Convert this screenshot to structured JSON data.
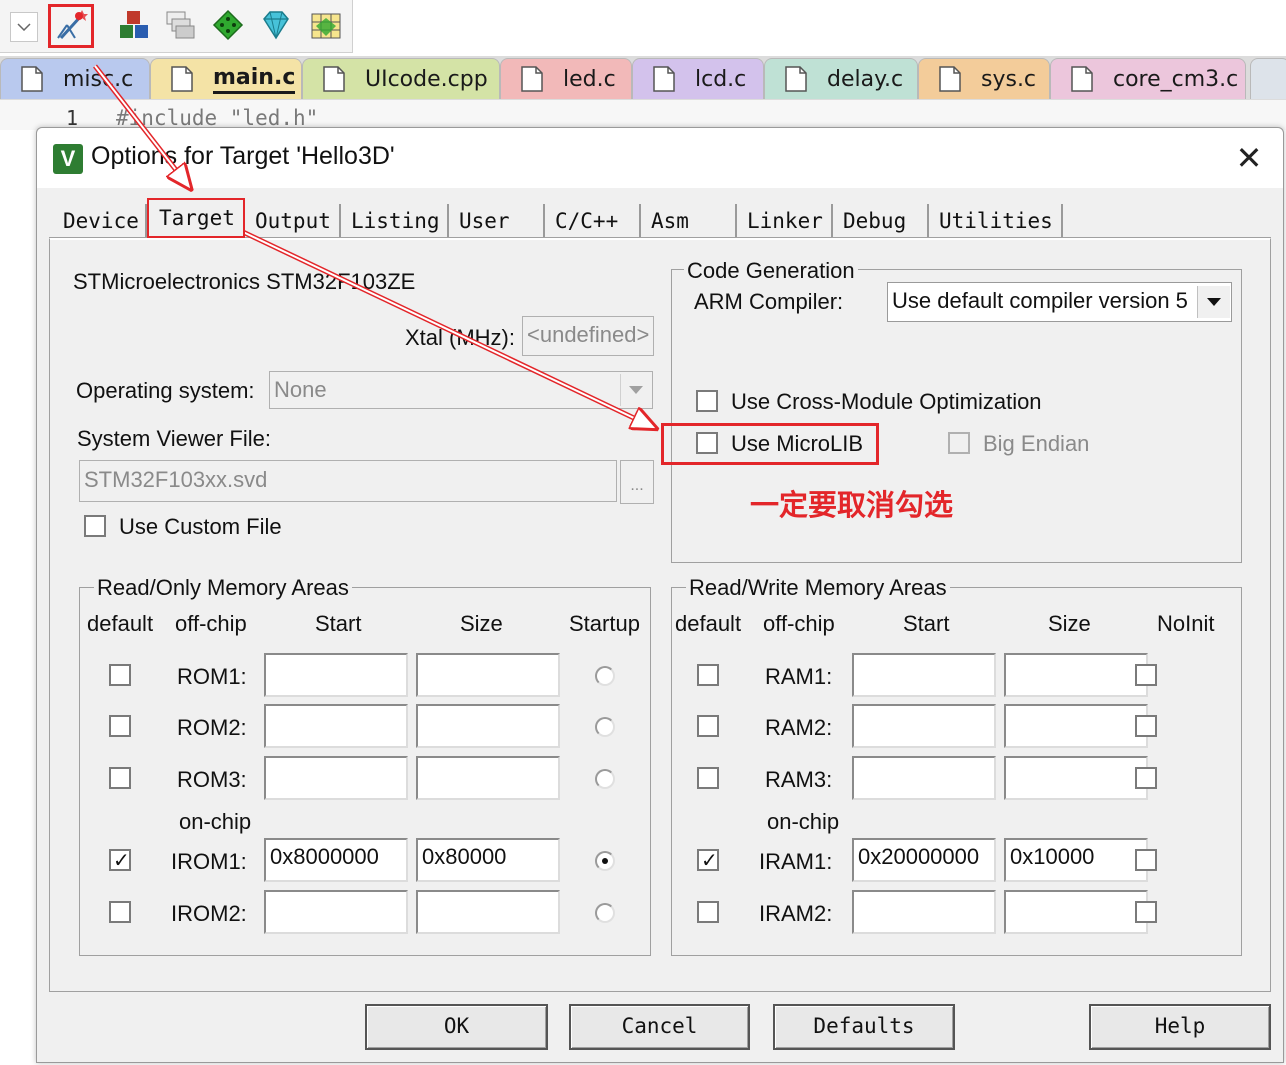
{
  "toolbar": {
    "icons": [
      "dropdown-icon",
      "magic-wand-options-icon",
      "blocks-icon",
      "windows-stack-icon",
      "green-diamond-icon",
      "gem-icon",
      "grid-gem-icon"
    ]
  },
  "editor": {
    "tabs": [
      {
        "label": "misc.c",
        "color": "#b9c9ee",
        "active": false
      },
      {
        "label": "main.c",
        "color": "#f4e3a6",
        "active": true
      },
      {
        "label": "UIcode.cpp",
        "color": "#d4e3a6",
        "active": false
      },
      {
        "label": "led.c",
        "color": "#f2b9b9",
        "active": false
      },
      {
        "label": "lcd.c",
        "color": "#d3c2ec",
        "active": false
      },
      {
        "label": "delay.c",
        "color": "#bfe1d5",
        "active": false
      },
      {
        "label": "sys.c",
        "color": "#f3cc9a",
        "active": false
      },
      {
        "label": "core_cm3.c",
        "color": "#ecc6dc",
        "active": false
      }
    ],
    "line_number": "1",
    "code_line": "#include \"led.h\""
  },
  "dialog": {
    "title": "Options for Target 'Hello3D'",
    "icon_letter": "V",
    "close_symbol": "✕",
    "tabs": [
      "Device",
      "Target",
      "Output",
      "Listing",
      "User",
      "C/C++",
      "Asm",
      "Linker",
      "Debug",
      "Utilities"
    ],
    "active_tab": "Target"
  },
  "target": {
    "device": "STMicroelectronics STM32F103ZE",
    "xtal_label": "Xtal (MHz):",
    "xtal_value": "<undefined>",
    "os_label": "Operating system:",
    "os_value": "None",
    "svd_label": "System Viewer File:",
    "svd_value": "STM32F103xx.svd",
    "browse_label": "...",
    "use_custom_file": "Use Custom File"
  },
  "code_gen": {
    "group_label": "Code Generation",
    "compiler_label": "ARM Compiler:",
    "compiler_value": "Use default compiler version 5",
    "cross_module": "Use Cross-Module Optimization",
    "microlib": "Use MicroLIB",
    "big_endian": "Big Endian"
  },
  "rom": {
    "group_label": "Read/Only Memory Areas",
    "headers": {
      "default": "default",
      "offchip": "off-chip",
      "start": "Start",
      "size": "Size",
      "extra": "Startup"
    },
    "onchip_label": "on-chip",
    "rows": [
      {
        "label": "ROM1:",
        "start": "",
        "size": "",
        "default": false,
        "startup": false
      },
      {
        "label": "ROM2:",
        "start": "",
        "size": "",
        "default": false,
        "startup": false
      },
      {
        "label": "ROM3:",
        "start": "",
        "size": "",
        "default": false,
        "startup": false
      },
      {
        "label": "IROM1:",
        "start": "0x8000000",
        "size": "0x80000",
        "default": true,
        "startup": true
      },
      {
        "label": "IROM2:",
        "start": "",
        "size": "",
        "default": false,
        "startup": false
      }
    ]
  },
  "ram": {
    "group_label": "Read/Write Memory Areas",
    "headers": {
      "default": "default",
      "offchip": "off-chip",
      "start": "Start",
      "size": "Size",
      "extra": "NoInit"
    },
    "onchip_label": "on-chip",
    "rows": [
      {
        "label": "RAM1:",
        "start": "",
        "size": "",
        "default": false,
        "noinit": false
      },
      {
        "label": "RAM2:",
        "start": "",
        "size": "",
        "default": false,
        "noinit": false
      },
      {
        "label": "RAM3:",
        "start": "",
        "size": "",
        "default": false,
        "noinit": false
      },
      {
        "label": "IRAM1:",
        "start": "0x20000000",
        "size": "0x10000",
        "default": true,
        "noinit": false
      },
      {
        "label": "IRAM2:",
        "start": "",
        "size": "",
        "default": false,
        "noinit": false
      }
    ]
  },
  "buttons": {
    "ok": "OK",
    "cancel": "Cancel",
    "defaults": "Defaults",
    "help": "Help"
  },
  "annotation": {
    "note": "一定要取消勾选",
    "color": "#e3262a"
  }
}
